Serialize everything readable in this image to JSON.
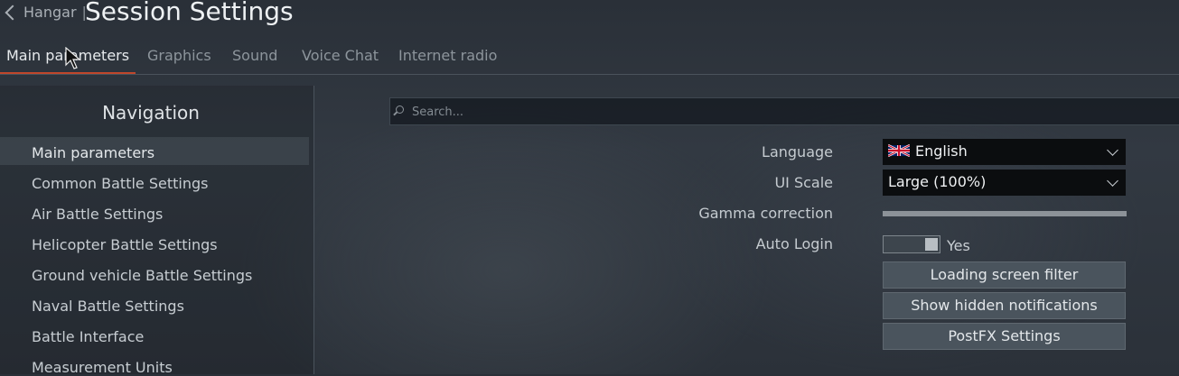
{
  "header": {
    "back_label": "Hangar",
    "separator": "|",
    "title": "Session Settings"
  },
  "tabs": [
    {
      "label": "Main parameters",
      "active": true
    },
    {
      "label": "Graphics",
      "active": false
    },
    {
      "label": "Sound",
      "active": false
    },
    {
      "label": "Voice Chat",
      "active": false
    },
    {
      "label": "Internet radio",
      "active": false
    }
  ],
  "navigation": {
    "title": "Navigation",
    "items": [
      {
        "label": "Main parameters",
        "active": true
      },
      {
        "label": "Common Battle Settings"
      },
      {
        "label": "Air Battle Settings"
      },
      {
        "label": "Helicopter Battle Settings"
      },
      {
        "label": "Ground vehicle Battle Settings"
      },
      {
        "label": "Naval Battle Settings"
      },
      {
        "label": "Battle Interface"
      },
      {
        "label": "Measurement Units"
      }
    ]
  },
  "search": {
    "placeholder": "Search...",
    "value": ""
  },
  "settings": {
    "language": {
      "label": "Language",
      "value": "English",
      "icon": "uk-flag-icon"
    },
    "ui_scale": {
      "label": "UI Scale",
      "value": "Large (100%)"
    },
    "gamma": {
      "label": "Gamma correction"
    },
    "auto_login": {
      "label": "Auto Login",
      "value": "Yes"
    },
    "buttons": {
      "loading_screen_filter": "Loading screen filter",
      "show_hidden_notifications": "Show hidden notifications",
      "postfx_settings": "PostFX Settings"
    }
  },
  "colors": {
    "accent": "#c0472b",
    "select_bg": "#0b0d0f",
    "button_bg": "#4a545d"
  }
}
